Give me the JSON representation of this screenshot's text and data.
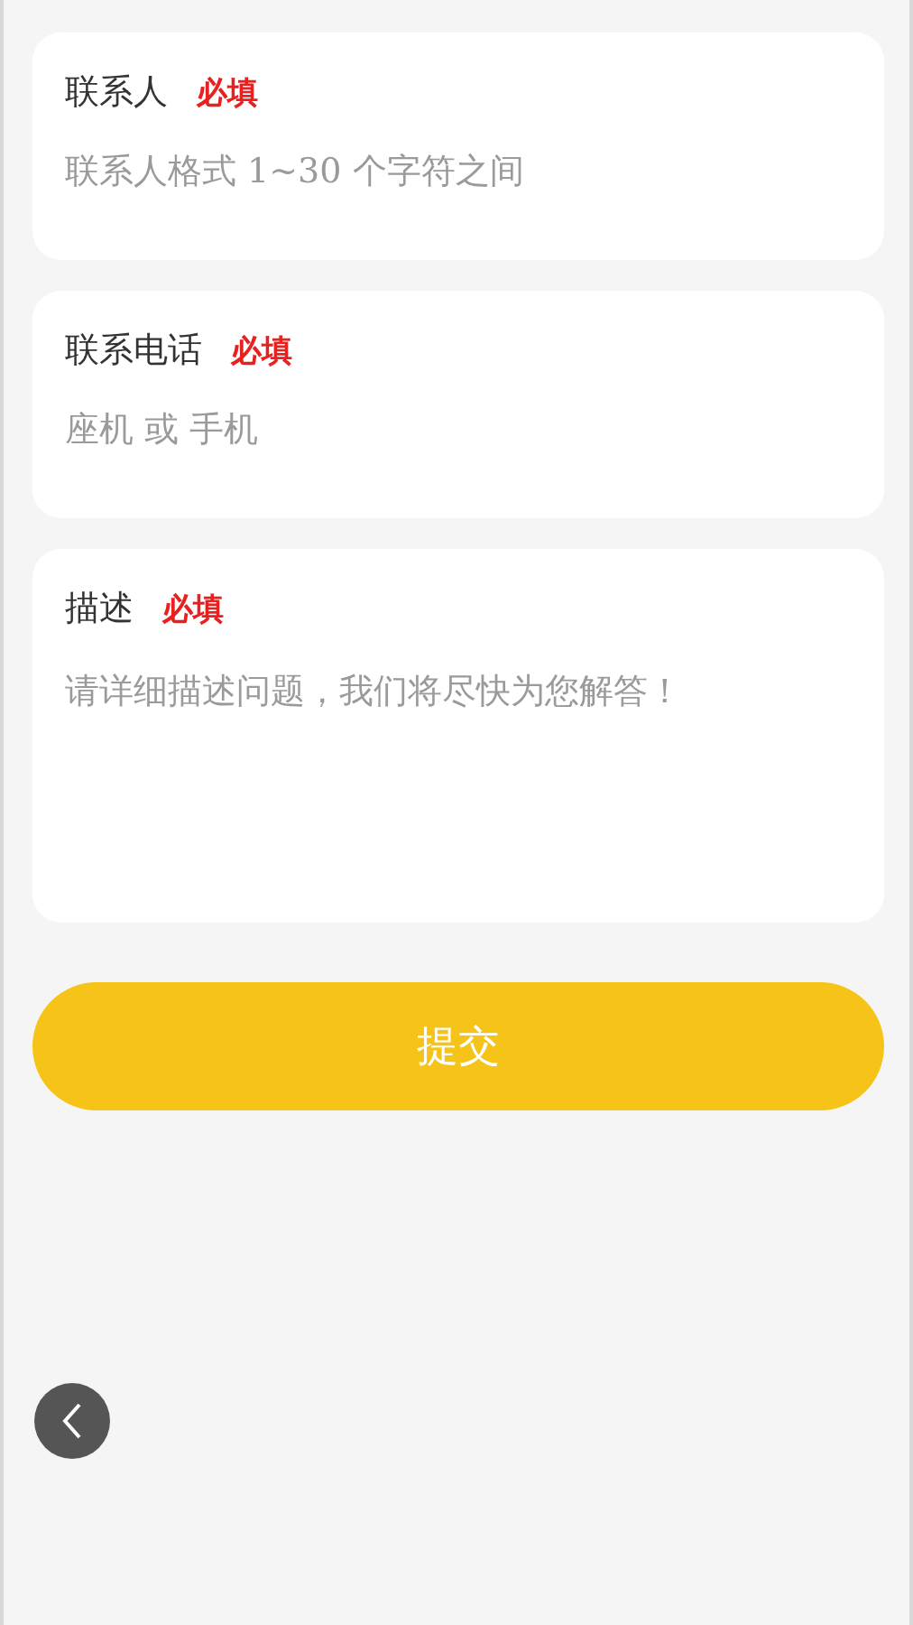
{
  "fields": [
    {
      "kind": "input",
      "label": "联系人",
      "required": "必填",
      "placeholder": "联系人格式 1~30 个字符之间"
    },
    {
      "kind": "input",
      "label": "联系电话",
      "required": "必填",
      "placeholder": "座机 或 手机"
    },
    {
      "kind": "textarea",
      "label": "描述",
      "required": "必填",
      "placeholder": "请详细描述问题，我们将尽快为您解答！"
    }
  ],
  "submit": "提交"
}
